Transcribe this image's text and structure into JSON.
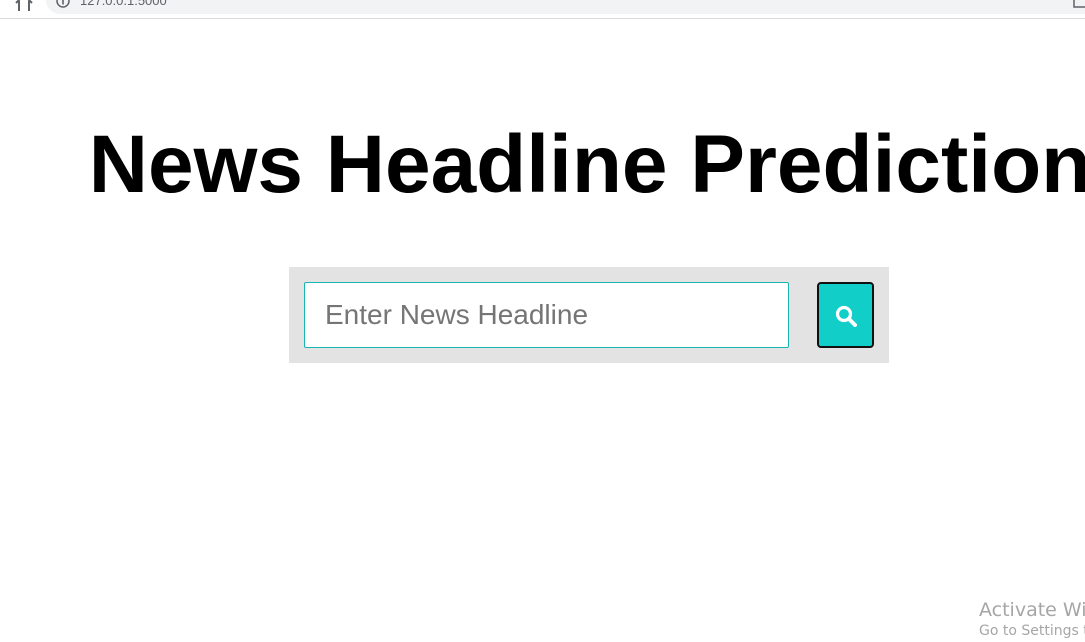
{
  "browser": {
    "url": "127.0.0.1:5000",
    "icons": [
      "home-icon",
      "info-icon",
      "extension-icon"
    ]
  },
  "main": {
    "title": "News Headline Prediction",
    "search": {
      "placeholder": "Enter News Headline",
      "value": "",
      "button_icon": "search-icon"
    }
  },
  "watermark": {
    "title": "Activate Wir",
    "subtitle": "Go to Settings t"
  },
  "colors": {
    "accent": "#12cec9",
    "input_border": "#17b6b1",
    "panel_background": "#e3e3e3",
    "title_text": "#000000"
  }
}
